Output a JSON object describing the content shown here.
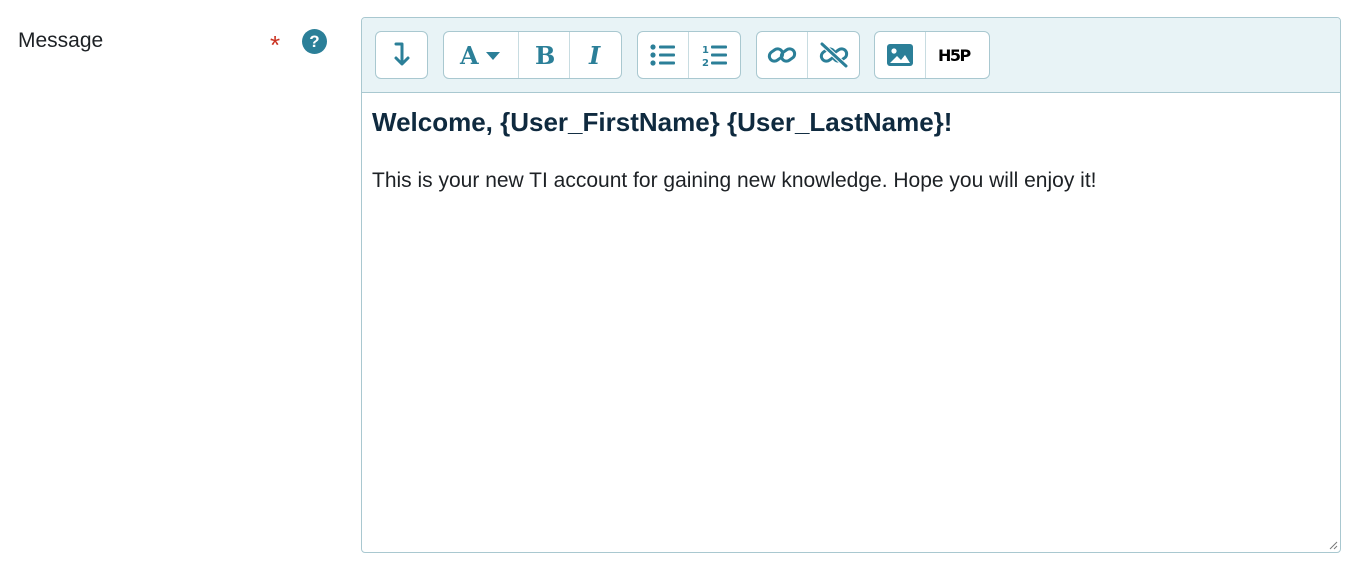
{
  "field": {
    "label": "Message",
    "required_mark": "*",
    "help_glyph": "?"
  },
  "toolbar": {
    "groups": [
      [
        {
          "icon": "expand-toolbar-icon"
        }
      ],
      [
        {
          "icon": "font-format-dropdown-icon"
        },
        {
          "icon": "bold-icon"
        },
        {
          "icon": "italic-icon"
        }
      ],
      [
        {
          "icon": "unordered-list-icon"
        },
        {
          "icon": "ordered-list-icon"
        }
      ],
      [
        {
          "icon": "link-icon"
        },
        {
          "icon": "unlink-icon"
        }
      ],
      [
        {
          "icon": "image-icon"
        },
        {
          "icon": "h5p-icon"
        }
      ]
    ],
    "font_letter": "A",
    "bold_letter": "B",
    "italic_letter": "I",
    "h5p_label": "H5P",
    "ordered_list_numbers": [
      "1",
      "2"
    ]
  },
  "content": {
    "heading": "Welcome, {User_FirstName} {User_LastName}!",
    "paragraph": "This is your new TI account for gaining new knowledge. Hope you will enjoy it!"
  },
  "colors": {
    "accent": "#2b7f98",
    "toolbar_bg": "#e8f3f6",
    "border": "#a9c8d0",
    "required": "#ca3120"
  }
}
